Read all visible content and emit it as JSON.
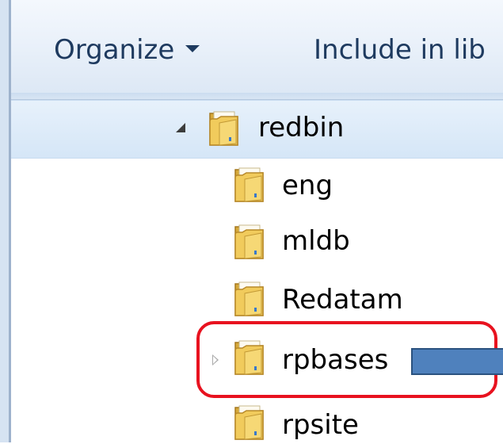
{
  "toolbar": {
    "organize_label": "Organize",
    "include_label": "Include in lib"
  },
  "tree": {
    "parent": {
      "label": "redbin",
      "state": "expanded",
      "selected": true
    },
    "children": [
      {
        "label": "eng"
      },
      {
        "label": "mldb"
      },
      {
        "label": "Redatam"
      },
      {
        "label": "rpbases",
        "has_children": true,
        "highlighted": true
      },
      {
        "label": "rpsite"
      }
    ]
  },
  "icons": {
    "folder": "folder-icon",
    "expand": "expanded-triangle-icon",
    "collapse": "collapsed-triangle-icon",
    "dropdown": "dropdown-arrow-icon"
  },
  "colors": {
    "highlight": "#e8121f",
    "arrow": "#4f81bd",
    "selection": "#d5e6f7",
    "toolbar_text": "#1e3a5f"
  }
}
